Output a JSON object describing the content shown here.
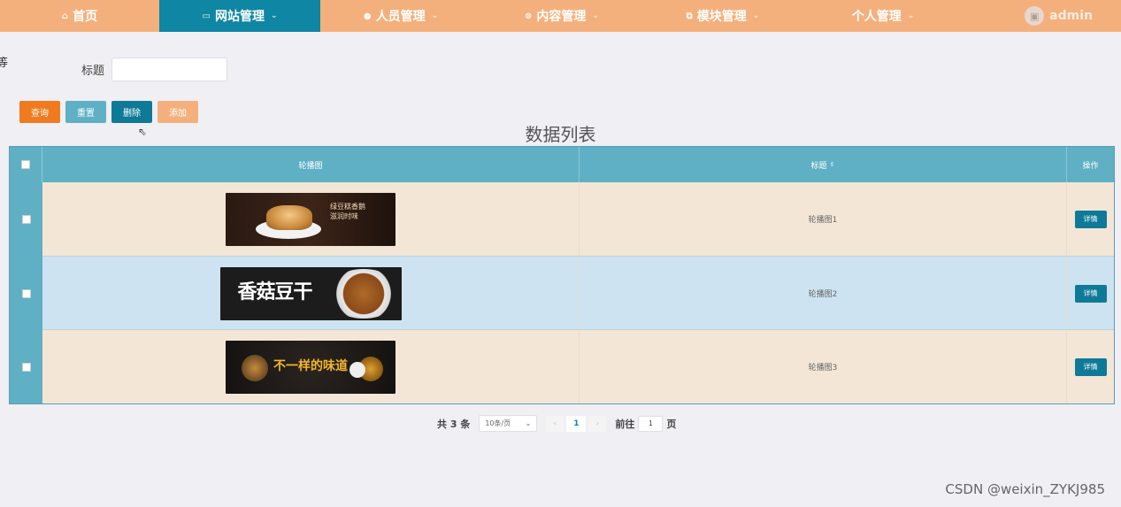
{
  "nav": {
    "items": [
      {
        "label": "首页",
        "icon": "home-icon",
        "active": false
      },
      {
        "label": "网站管理",
        "icon": "monitor-icon",
        "active": true
      },
      {
        "label": "人员管理",
        "icon": "user-icon",
        "active": false
      },
      {
        "label": "内容管理",
        "icon": "content-icon",
        "active": false
      },
      {
        "label": "模块管理",
        "icon": "module-icon",
        "active": false
      },
      {
        "label": "个人管理",
        "icon": "",
        "active": false
      }
    ],
    "user": "admin",
    "active_color": "#0f86a4",
    "bar_color": "#f4b07c"
  },
  "edge_char": "等",
  "search": {
    "label": "标题",
    "value": ""
  },
  "buttons": {
    "query": "查询",
    "reset": "重置",
    "delete": "删除",
    "add": "添加"
  },
  "table": {
    "title": "数据列表",
    "headers": {
      "image": "轮播图",
      "title": "标题",
      "op": "操作"
    },
    "rows": [
      {
        "title": "轮播图1",
        "detail": "详情",
        "banner_text": "绿豆糕香鹅\n滋润时味"
      },
      {
        "title": "轮播图2",
        "detail": "详情",
        "banner_text": "香菇豆干"
      },
      {
        "title": "轮播图3",
        "detail": "详情",
        "banner_text": "不一样的味道"
      }
    ]
  },
  "pager": {
    "total": "共 3 条",
    "page_size": "10条/页",
    "current": "1",
    "goto_label": "前往",
    "goto_value": "1",
    "page_suffix": "页"
  },
  "watermark": "CSDN @weixin_ZYKJ985"
}
